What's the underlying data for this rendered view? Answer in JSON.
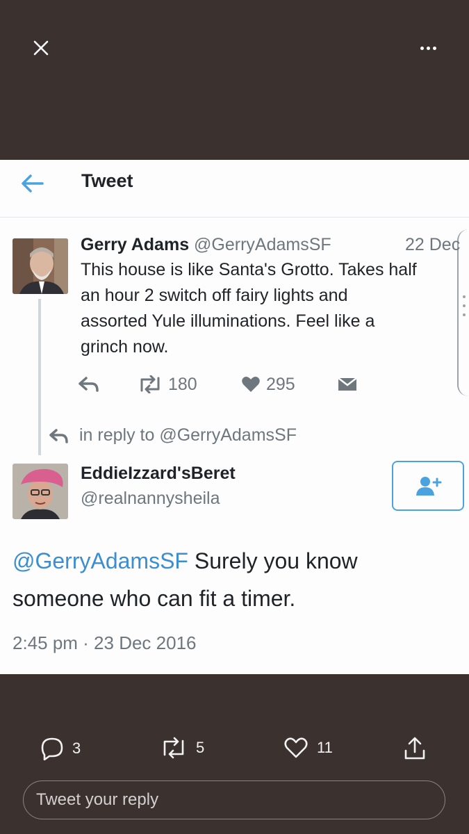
{
  "screenshot": {
    "header_title": "Tweet",
    "original": {
      "name": "Gerry Adams",
      "handle": "@GerryAdamsSF",
      "date": "22 Dec",
      "text": "This house is like Santa's Grotto. Takes half\nan hour 2 switch off fairy lights and\nassorted Yule illuminations. Feel like a\ngrinch now.",
      "retweets": "180",
      "likes": "295"
    },
    "reply_to": "in reply to @GerryAdamsSF",
    "reply": {
      "name": "EddieIzzard'sBeret",
      "handle": "@realnannysheila",
      "mention": "@GerryAdamsSF",
      "text": " Surely you know someone who can fit a timer.",
      "timestamp": "2:45 pm · 23 Dec 2016"
    }
  },
  "viewer": {
    "reply_count": "3",
    "retweet_count": "5",
    "like_count": "11",
    "reply_placeholder": "Tweet your reply"
  },
  "colors": {
    "background": "#3b3230",
    "link_blue": "#3b8ed0",
    "twitter_blue": "#4aa3df"
  },
  "icons": [
    "close-icon",
    "more-icon",
    "back-arrow-icon",
    "reply-icon",
    "retweet-icon",
    "heart-icon",
    "direct-message-icon",
    "follow-icon",
    "share-icon"
  ]
}
